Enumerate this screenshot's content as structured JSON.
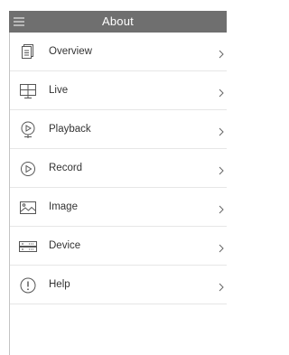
{
  "header": {
    "title": "About",
    "background": "#6f6f6f",
    "menu_icon": "hamburger-menu-icon"
  },
  "menu": {
    "items": [
      {
        "label": "Overview",
        "icon": "document-icon"
      },
      {
        "label": "Live",
        "icon": "monitor-icon"
      },
      {
        "label": "Playback",
        "icon": "playback-icon"
      },
      {
        "label": "Record",
        "icon": "record-play-icon"
      },
      {
        "label": "Image",
        "icon": "image-icon"
      },
      {
        "label": "Device",
        "icon": "device-icon"
      },
      {
        "label": "Help",
        "icon": "help-icon"
      }
    ],
    "chevron_icon": "chevron-right-icon"
  }
}
